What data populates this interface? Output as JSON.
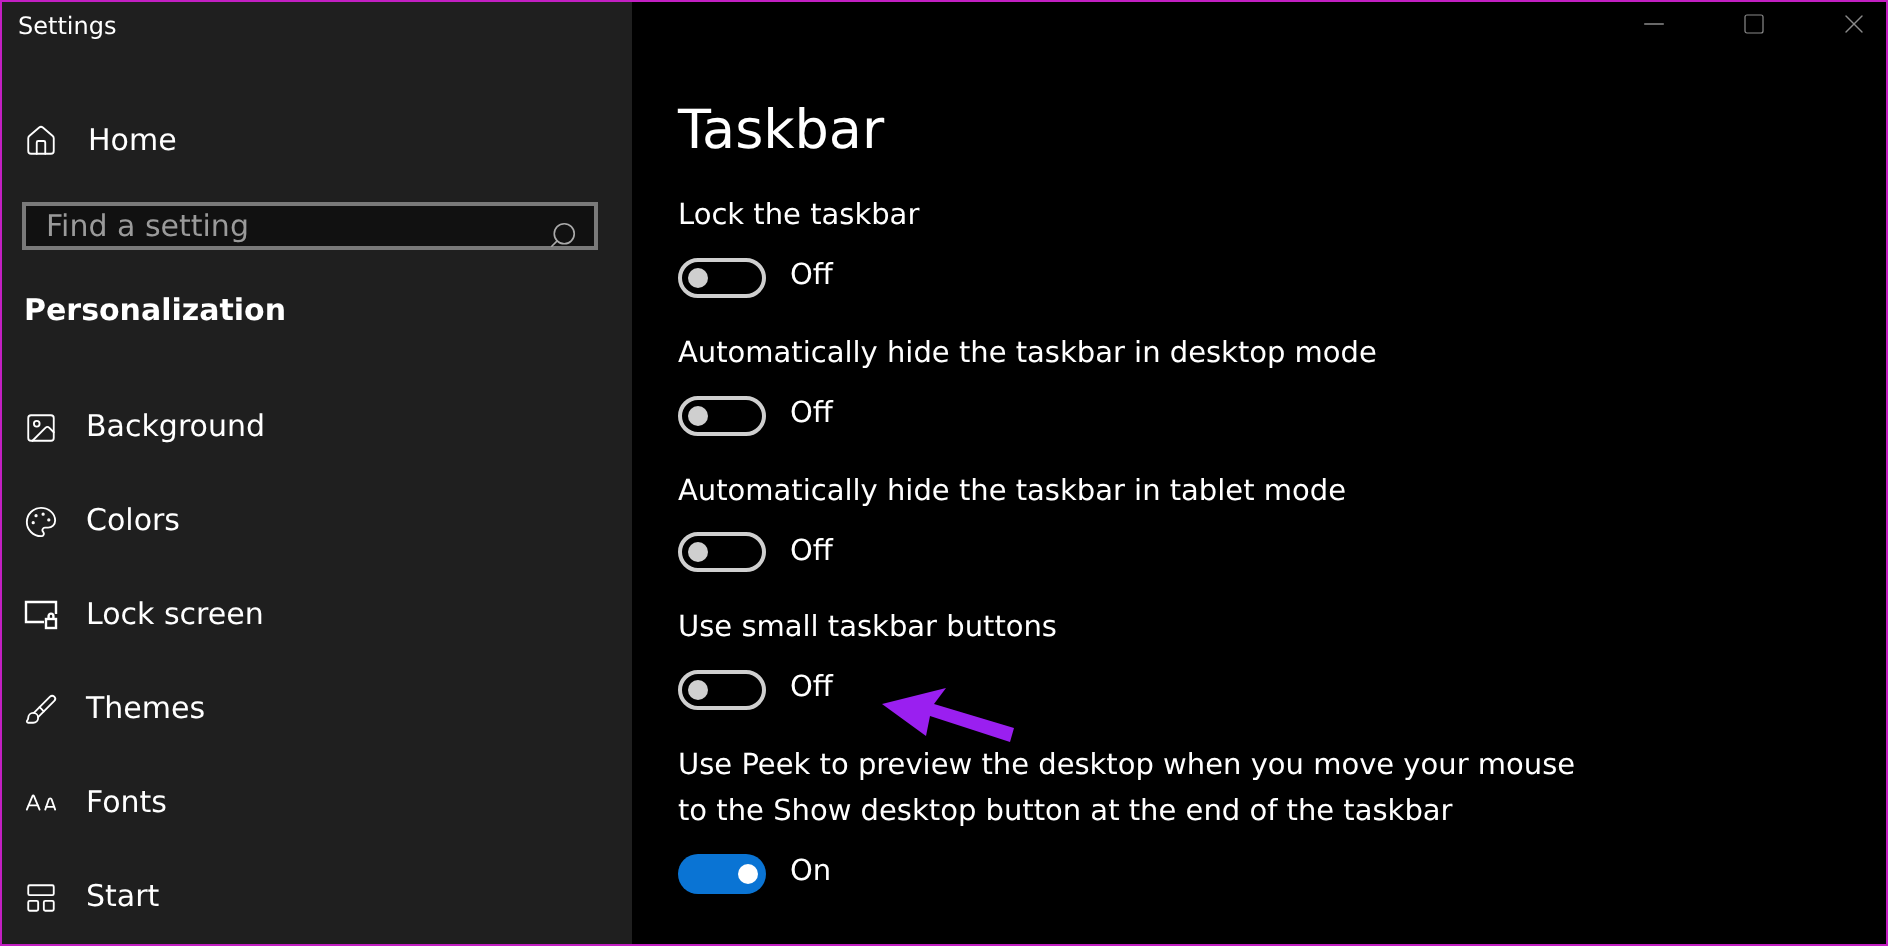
{
  "window": {
    "title": "Settings"
  },
  "sidebar": {
    "home": "Home",
    "search": {
      "placeholder": "Find a setting"
    },
    "section": "Personalization",
    "items": [
      {
        "label": "Background"
      },
      {
        "label": "Colors"
      },
      {
        "label": "Lock screen"
      },
      {
        "label": "Themes"
      },
      {
        "label": "Fonts"
      },
      {
        "label": "Start"
      }
    ]
  },
  "page": {
    "title": "Taskbar",
    "settings": [
      {
        "label": "Lock the taskbar",
        "on": false,
        "status": "Off"
      },
      {
        "label": "Automatically hide the taskbar in desktop mode",
        "on": false,
        "status": "Off"
      },
      {
        "label": "Automatically hide the taskbar in tablet mode",
        "on": false,
        "status": "Off"
      },
      {
        "label": "Use small taskbar buttons",
        "on": false,
        "status": "Off"
      },
      {
        "label": "Use Peek to preview the desktop when you move your mouse to the Show desktop button at the end of the taskbar",
        "on": true,
        "status": "On"
      }
    ]
  }
}
